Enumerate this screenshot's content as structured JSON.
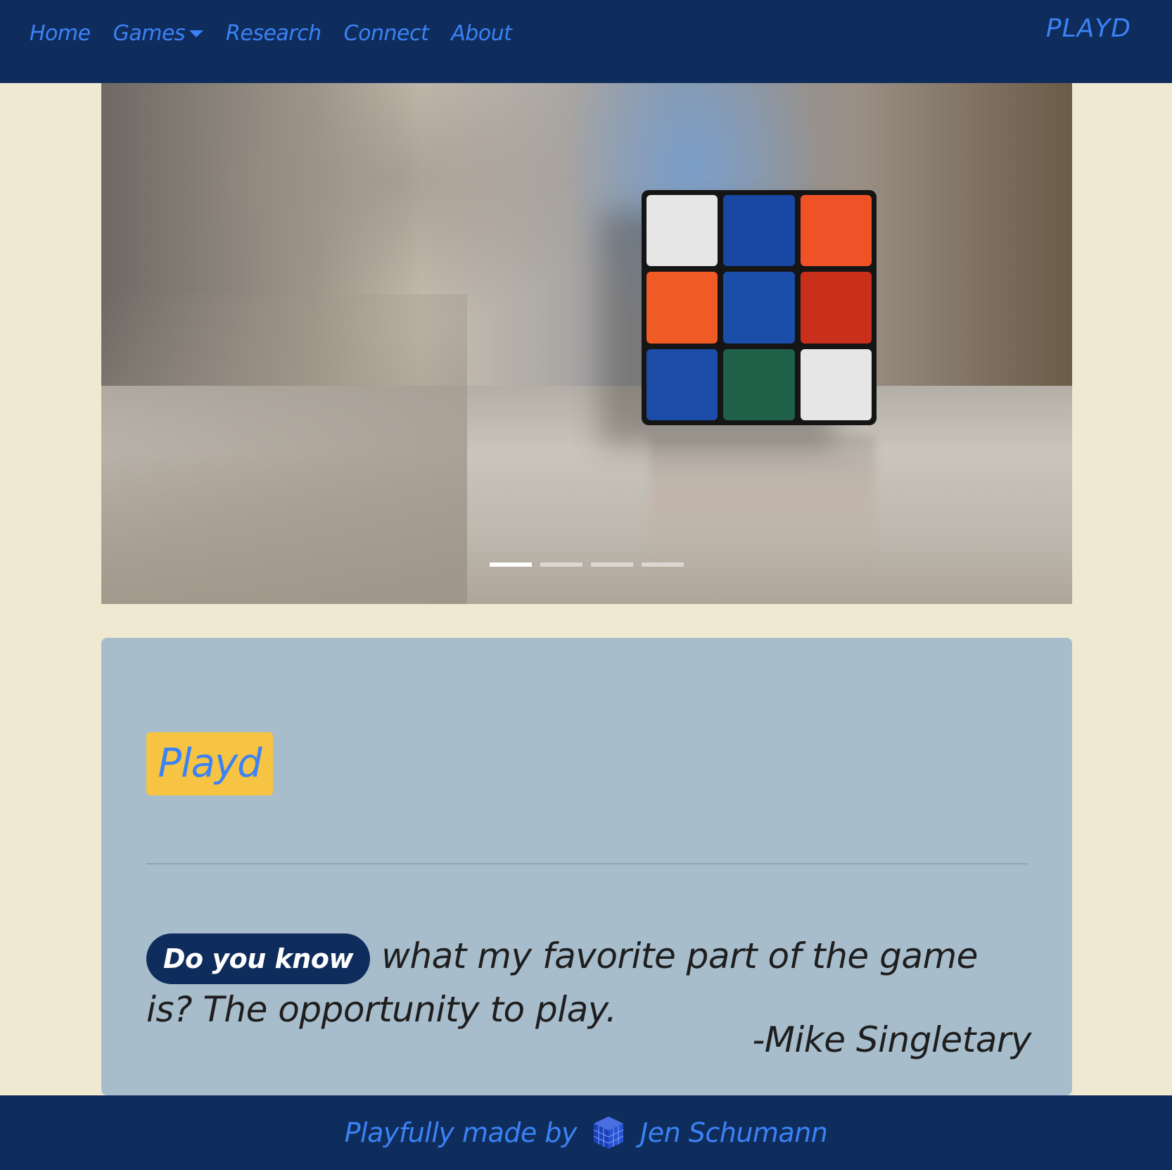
{
  "nav": {
    "items": [
      {
        "label": "Home"
      },
      {
        "label": "Games",
        "has_dropdown": true
      },
      {
        "label": "Research"
      },
      {
        "label": "Connect"
      },
      {
        "label": "About"
      }
    ],
    "brand": "PLAYD"
  },
  "carousel": {
    "image": "rubiks-cube-photo",
    "cube_colors": [
      "#e6e6e6",
      "#1848a4",
      "#f05228",
      "#f05a24",
      "#1a4ea8",
      "#c9301c",
      "#1a4ca8",
      "#1e6048",
      "#e6e6e6"
    ],
    "slide_count": 4,
    "active_slide": 1
  },
  "card": {
    "badge_title": "Playd",
    "quote_pill": "Do you know",
    "quote_text": "what my favorite part of the game is? The opportunity to play.",
    "author": "-Mike Singletary"
  },
  "footer": {
    "text": "Playfully made by",
    "logo_icon": "cube-logo-icon",
    "author": "Jen Schumann"
  },
  "colors": {
    "navbar_bg": "#0f2d5c",
    "link": "#3b82f6",
    "page_bg": "#efe9d2",
    "card_bg": "#a7bdcc",
    "badge_bg": "#f6c343"
  }
}
